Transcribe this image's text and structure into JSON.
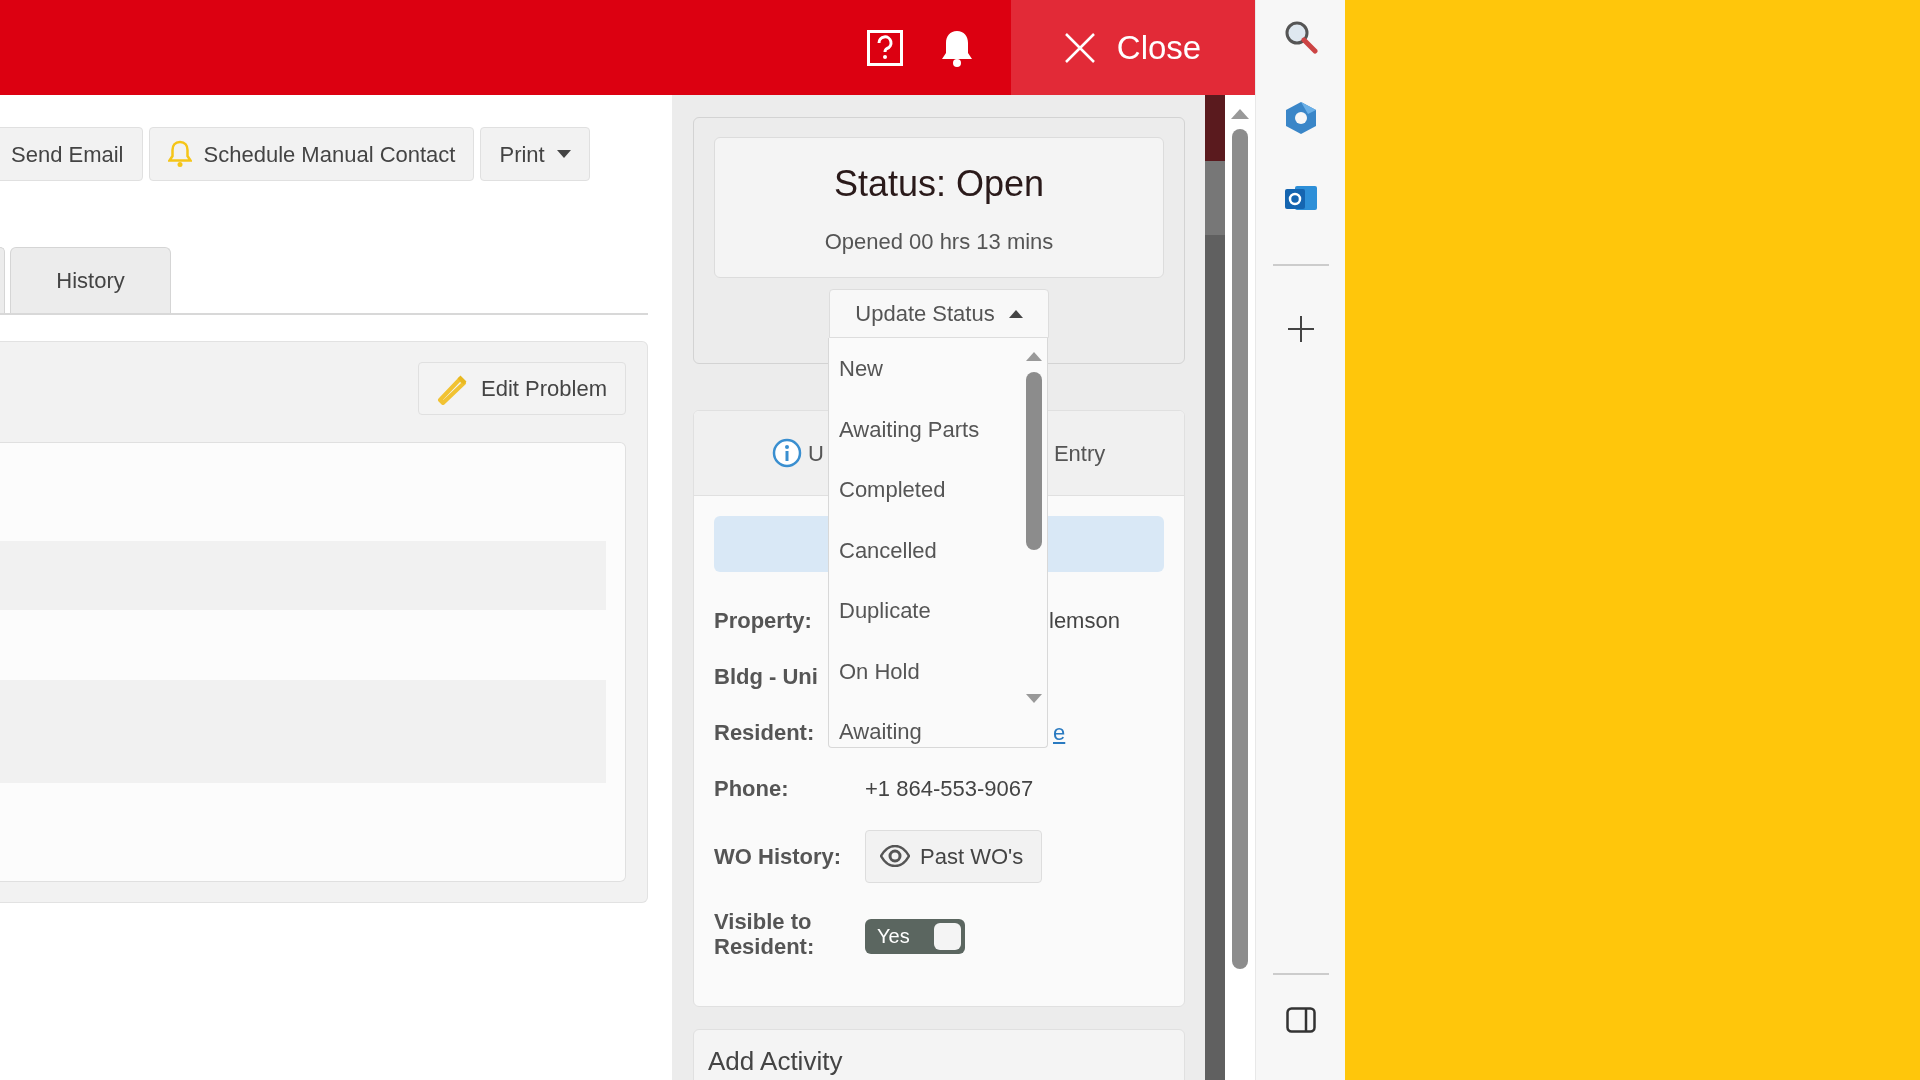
{
  "header": {
    "close_label": "Close"
  },
  "toolbar": [
    {
      "label": "Send Email",
      "kind": "plain"
    },
    {
      "label": "Schedule Manual Contact",
      "kind": "bell"
    },
    {
      "label": "Print",
      "kind": "dropdown"
    }
  ],
  "tabs": [
    {
      "label": "History",
      "selected": false
    }
  ],
  "problem_panel": {
    "edit_button": "Edit Problem"
  },
  "status_card": {
    "title": "Status: Open",
    "subtitle": "Opened 00 hrs 13 mins",
    "update_button": "Update Status",
    "expanded": true
  },
  "status_menu": [
    "New",
    "Awaiting Parts",
    "Completed",
    "Cancelled",
    "Duplicate",
    "On Hold",
    "Awaiting"
  ],
  "details": {
    "tab_left": "U",
    "tab_right": "Entry",
    "rows": [
      {
        "label": "Property:",
        "value": "lemson",
        "kind": "text"
      },
      {
        "label": "Bldg - Uni",
        "kind": "text"
      },
      {
        "label": "Resident:",
        "value": "e",
        "kind": "link"
      },
      {
        "label": "Phone:",
        "value": "+1 864-553-9067",
        "kind": "text"
      },
      {
        "label": "WO History:",
        "value": "Past WO's",
        "kind": "button"
      },
      {
        "label": "Visible to Resident:",
        "value": "Yes",
        "kind": "toggle",
        "on": true
      }
    ]
  },
  "add_activity": {
    "title": "Add Activity"
  }
}
